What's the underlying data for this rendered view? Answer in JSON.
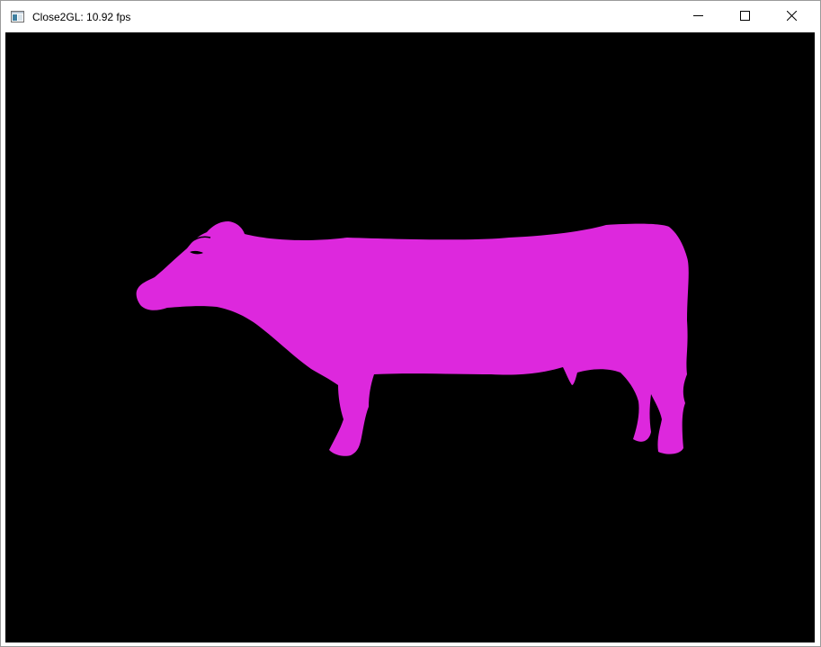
{
  "window": {
    "title": "Close2GL: 10.92 fps",
    "controls": {
      "minimize_icon": "minimize-icon",
      "maximize_icon": "maximize-icon",
      "close_icon": "close-icon"
    }
  },
  "viewport": {
    "background_color": "#000000",
    "model_color": "#dd28dd"
  },
  "colors": {
    "titlebar": "#ffffff",
    "model": "#dd28dd",
    "canvas": "#000000"
  }
}
